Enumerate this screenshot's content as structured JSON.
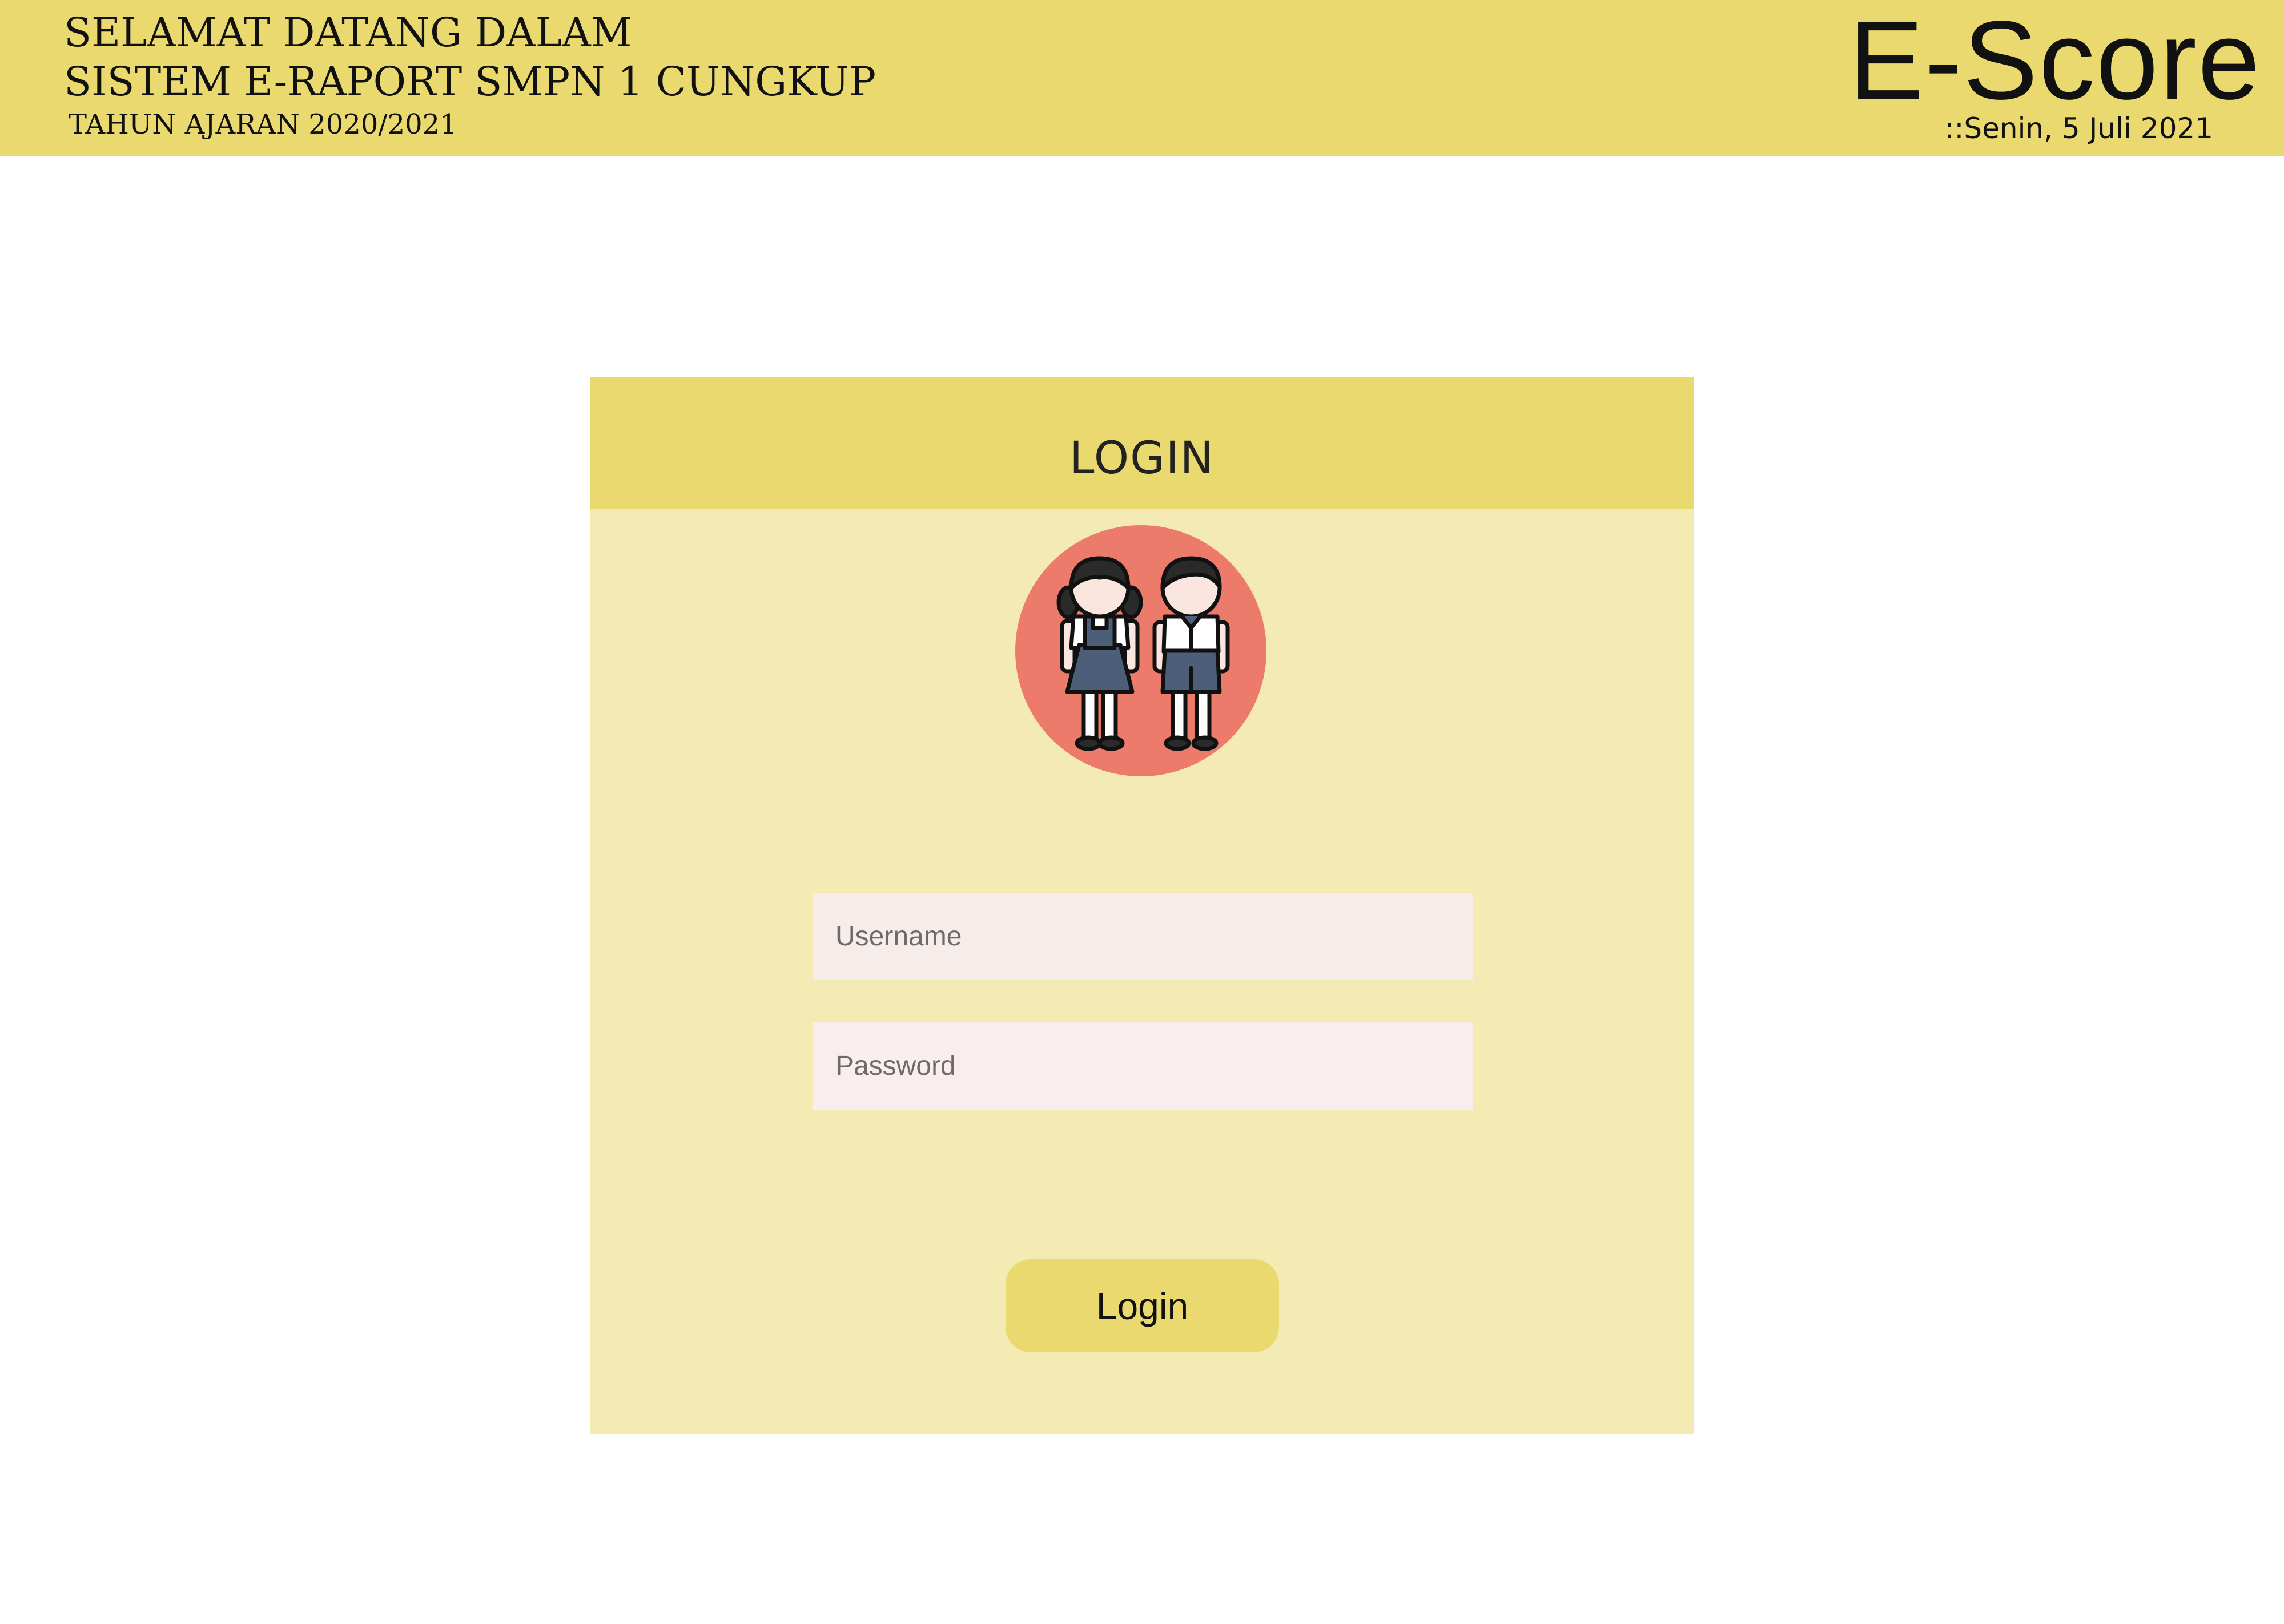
{
  "header": {
    "welcome_line_1": "SELAMAT DATANG DALAM",
    "welcome_line_2": "SISTEM E-RAPORT SMPN 1 CUNGKUP",
    "academic_year": "TAHUN AJARAN  2020/2021",
    "brand": "E-Score",
    "date": "::Senin, 5 Juli 2021"
  },
  "login_card": {
    "title": "LOGIN",
    "avatar_icon": "students-icon",
    "username_placeholder": "Username",
    "username_value": "",
    "password_placeholder": "Password",
    "password_value": "",
    "button_label": "Login"
  },
  "colors": {
    "header_bg": "#e9d96f",
    "card_bg": "#f4eab3",
    "avatar_circle": "#ec7b6c",
    "uniform_navy": "#4d5f78"
  }
}
